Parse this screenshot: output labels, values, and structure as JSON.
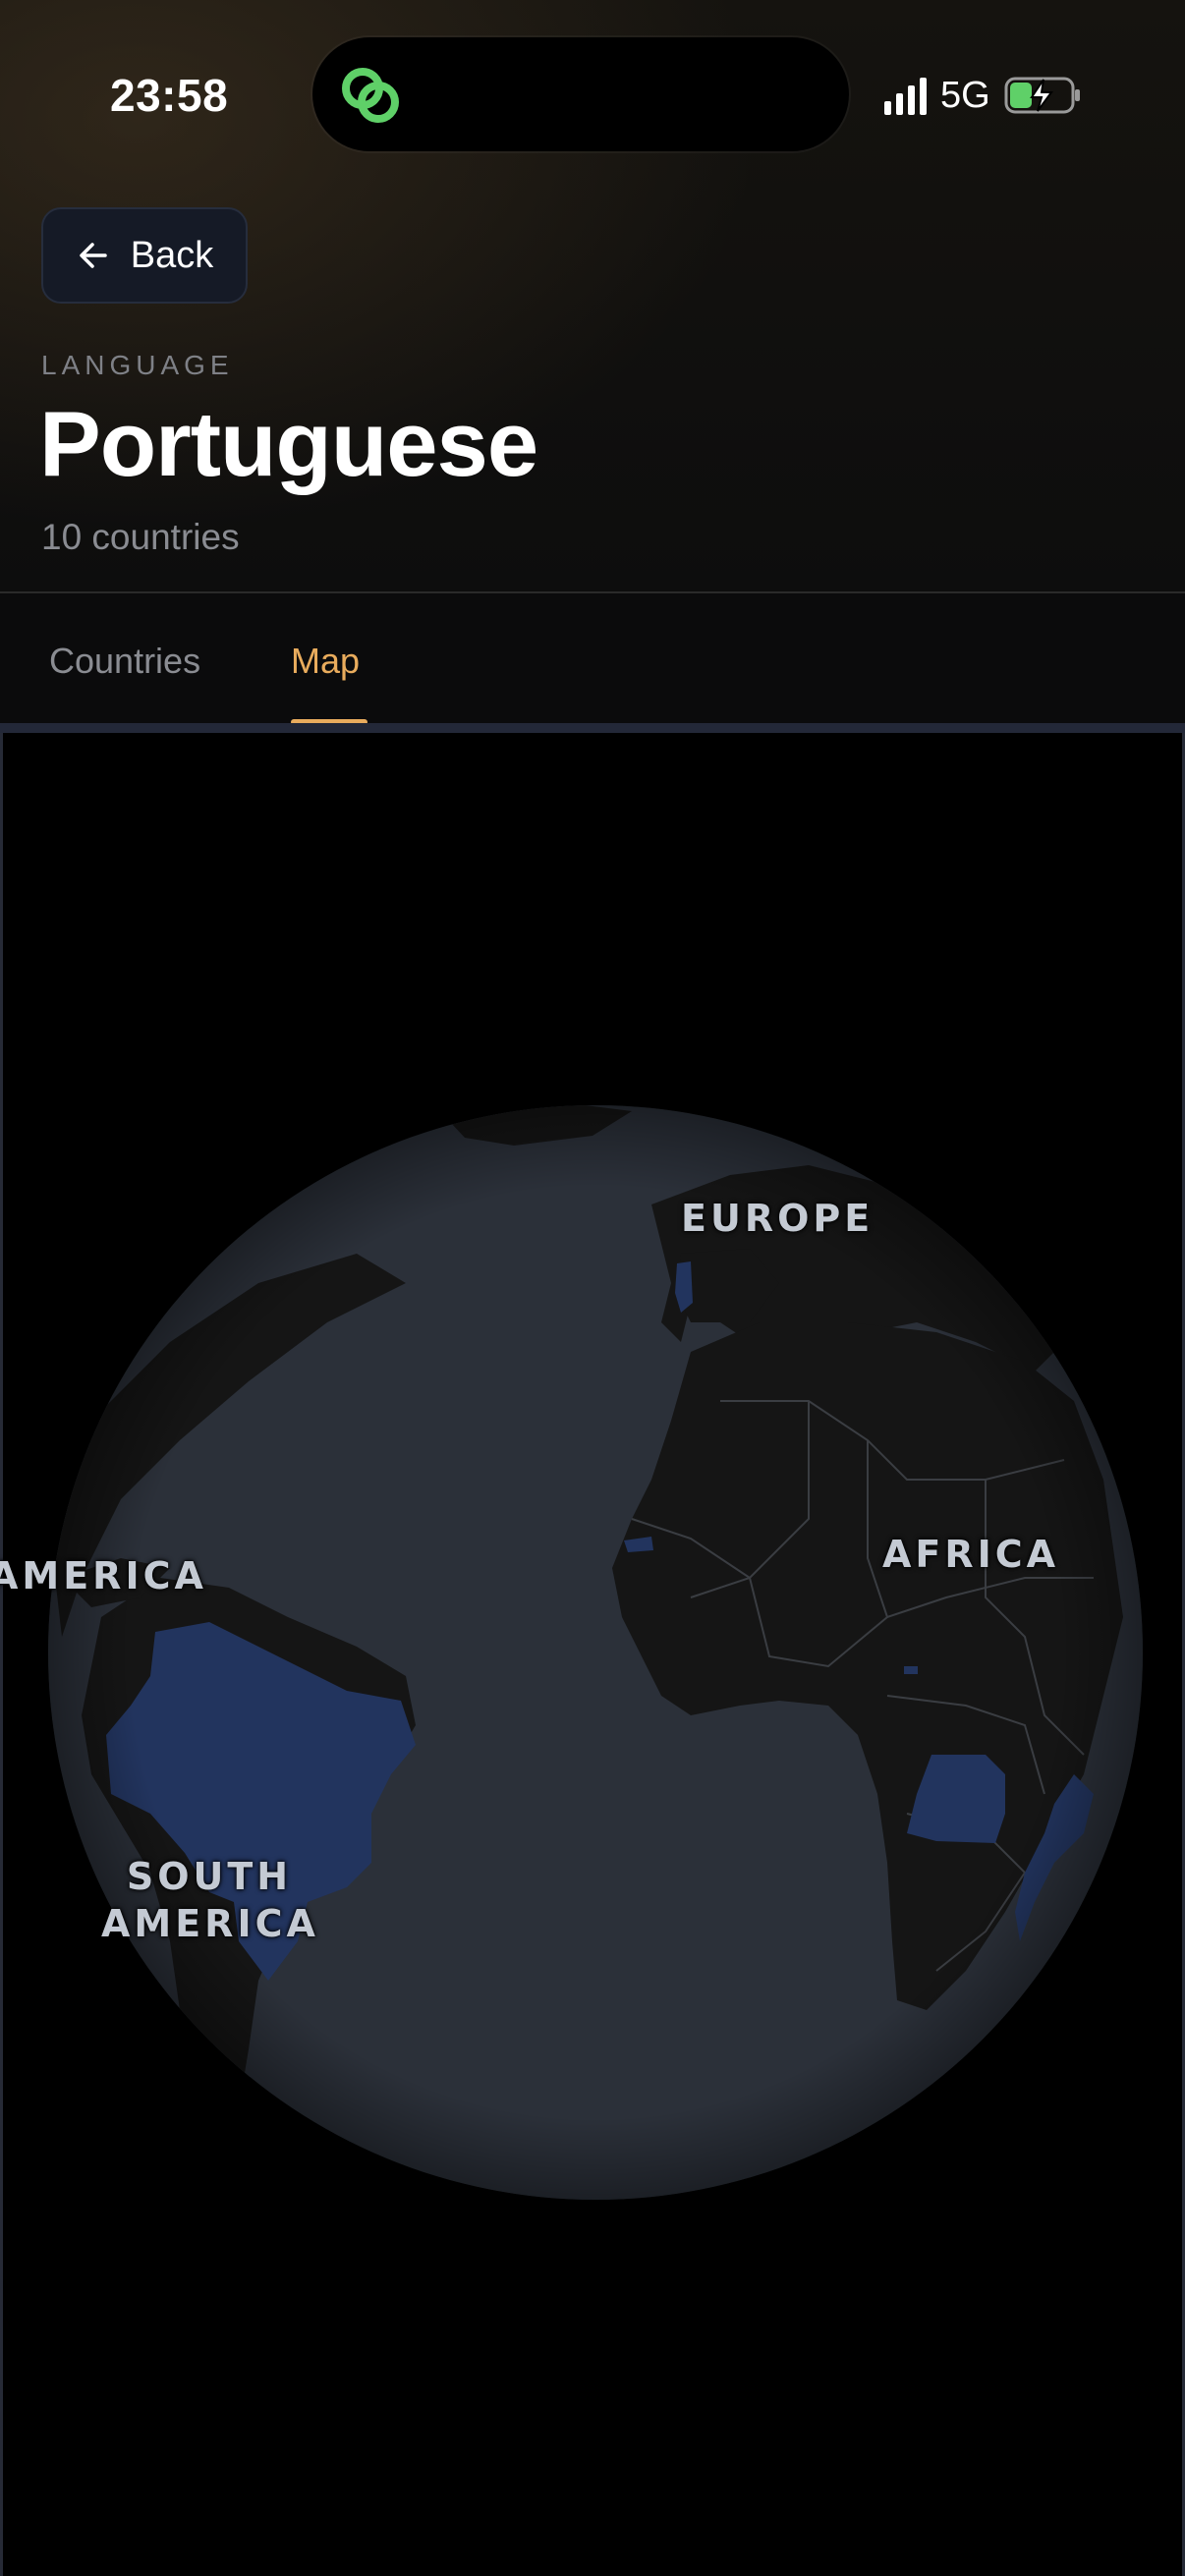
{
  "status_bar": {
    "time": "23:58",
    "network": "5G",
    "icons": [
      "app-link-icon",
      "signal-icon",
      "battery-charging-icon"
    ]
  },
  "header": {
    "back_label": "Back",
    "eyebrow": "LANGUAGE",
    "title": "Portuguese",
    "subtitle": "10 countries"
  },
  "tabs": [
    {
      "label": "Countries",
      "active": false
    },
    {
      "label": "Map",
      "active": true
    }
  ],
  "map": {
    "projection": "orthographic globe",
    "highlighted_countries_color": "#22345e",
    "ocean_color": "#2b3039",
    "land_color": "#151515",
    "labels": {
      "europe": "EUROPE",
      "africa": "AFRICA",
      "america": "AMERICA",
      "south_america_line1": "SOUTH",
      "south_america_line2": "AMERICA"
    }
  }
}
